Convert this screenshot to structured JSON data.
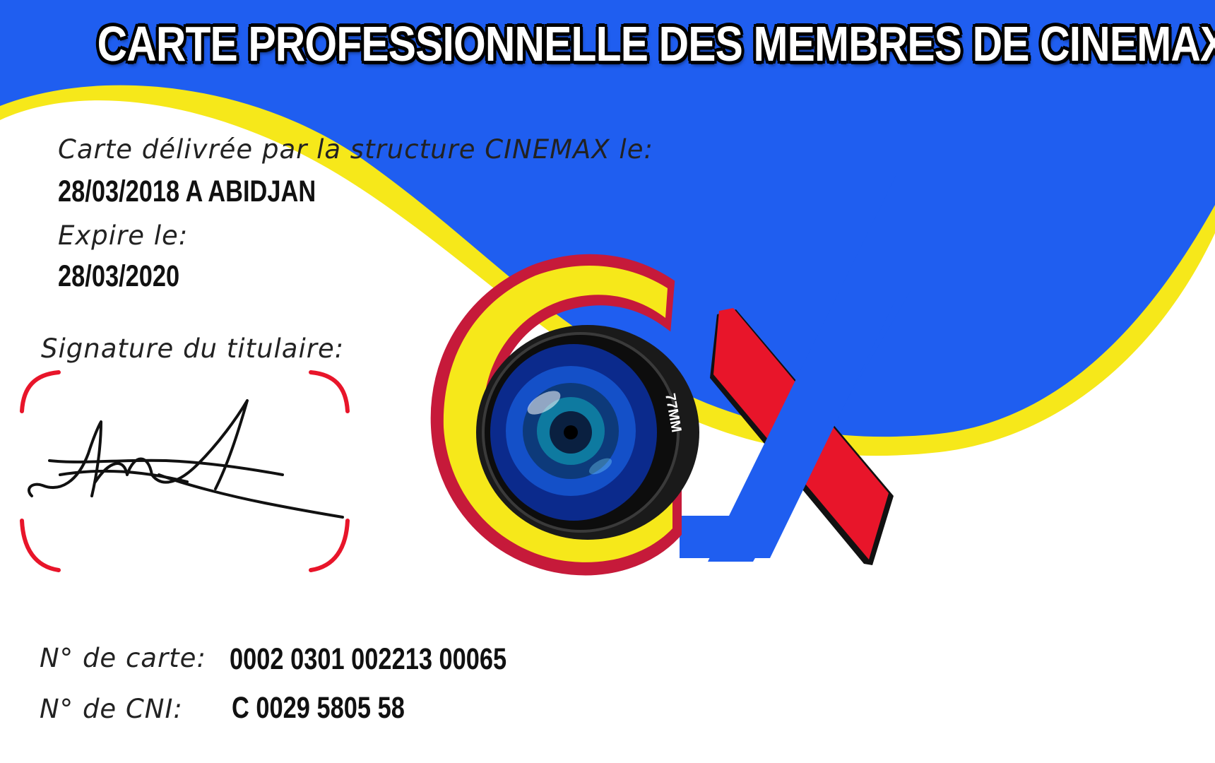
{
  "card": {
    "title": "CARTE PROFESSIONNELLE DES MEMBRES DE CINEMAX",
    "issued_label": "Carte délivrée par la structure CINEMAX le:",
    "issued_value": "28/03/2018 A ABIDJAN",
    "expires_label": "Expire le:",
    "expires_value": "28/03/2020",
    "signature_label": "Signature du titulaire:",
    "card_number_label": "N° de carte:",
    "card_number_value": "0002 0301 002213 00065",
    "id_number_label": "N° de CNI:",
    "id_number_value": "C 0029 5805 58",
    "lens_text": "77MM"
  },
  "colors": {
    "blue": "#1f5ef0",
    "yellow": "#f6e81a",
    "red": "#e8152a",
    "white": "#ffffff"
  },
  "icons": [
    "cinemax-logo-icon",
    "camera-lens-icon",
    "signature-icon",
    "signature-frame-icon"
  ]
}
